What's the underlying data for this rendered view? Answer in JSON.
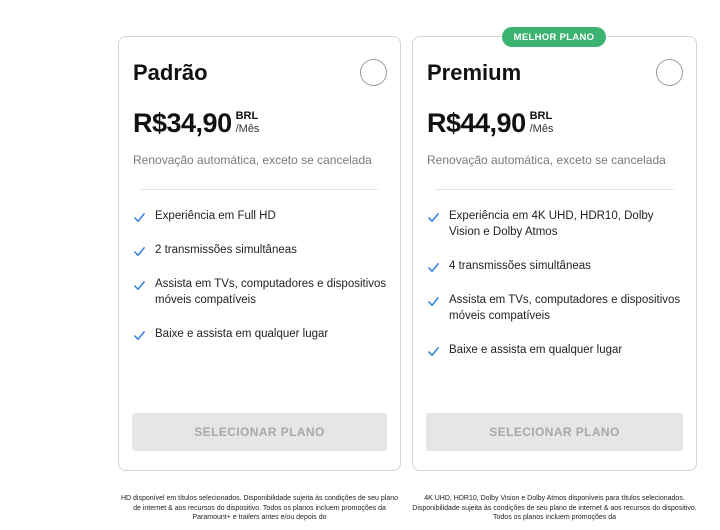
{
  "plans": [
    {
      "name": "Padrão",
      "price": "R$34,90",
      "currency": "BRL",
      "period": "/Mês",
      "renewal": "Renovação automática, exceto se cancelada",
      "features": [
        "Experiência em Full HD",
        "2 transmissões simultâneas",
        "Assista em TVs, computadores e dispositivos móveis compatíveis",
        "Baixe e assista em qualquer lugar"
      ],
      "button_label": "SELECIONAR PLANO",
      "footnote": "HD disponível em títulos selecionados. Disponibilidade sujeita às condições de seu plano de internet & aos recursos do dispositivo. Todos os planos incluem promoções da Paramount+ e trailers antes e/ou depois do"
    },
    {
      "name": "Premium",
      "badge": "MELHOR PLANO",
      "price": "R$44,90",
      "currency": "BRL",
      "period": "/Mês",
      "renewal": "Renovação automática, exceto se cancelada",
      "features": [
        "Experiência em 4K UHD, HDR10, Dolby Vision e Dolby Atmos",
        "4 transmissões simultâneas",
        "Assista em TVs, computadores e dispositivos móveis compatíveis",
        "Baixe e assista em qualquer lugar"
      ],
      "button_label": "SELECIONAR PLANO",
      "footnote": "4K UHD, HDR10, Dolby Vision e Dolby Atmos disponíveis para títulos selecionados. Disponibilidade sujeita às condições de seu plano de internet & aos recursos do dispositivo. Todos os planos incluem promoções da"
    }
  ],
  "colors": {
    "badge": "#3cb371",
    "check": "#2a7de1",
    "button_bg": "#e6e6e6",
    "button_text": "#a8a8a8"
  },
  "icons": {
    "check": "checkmark-icon",
    "radio": "radio-circle"
  }
}
